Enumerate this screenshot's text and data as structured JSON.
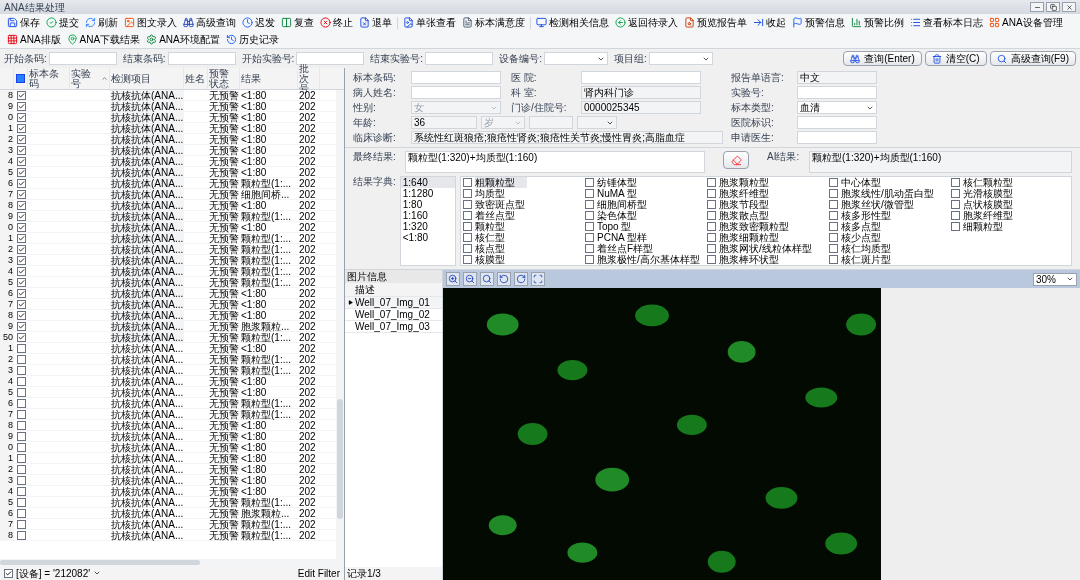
{
  "window": {
    "title": "ANA结果处理"
  },
  "toolbar": [
    [
      "保存",
      "提交",
      "刷新",
      "图文录入",
      "高级查询",
      "迟发",
      "复查",
      "终止",
      "退单"
    ],
    [
      "单张查看",
      "标本满意度"
    ],
    [
      "检测相关信息",
      "返回待录入",
      "预览报告单",
      "收起",
      "预警信息",
      "预警比例",
      "查看标本日志",
      "ANA设备管理",
      "ANA排版",
      "ANA下载结果",
      "ANA环境配置",
      "历史记录"
    ]
  ],
  "filters": [
    {
      "label": "开始条码:",
      "kind": "text"
    },
    {
      "label": "结束条码:",
      "kind": "text"
    },
    {
      "label": "开始实验号:",
      "kind": "text"
    },
    {
      "label": "结束实验号:",
      "kind": "text"
    },
    {
      "label": "设备编号:",
      "kind": "select"
    },
    {
      "label": "项目组:",
      "kind": "select"
    }
  ],
  "query_buttons": [
    "查询(Enter)",
    "清空(C)",
    "高级查询(F9)"
  ],
  "table": {
    "select_all_indeterminate": true,
    "columns": [
      {
        "label": "标本条码",
        "sorted": false
      },
      {
        "label": "实验号",
        "sorted": true
      },
      {
        "label": "检测项目",
        "sorted": false
      },
      {
        "label": "姓名",
        "sorted": false
      },
      {
        "label": "预警状态",
        "sorted": false
      },
      {
        "label": "结果",
        "sorted": false
      },
      {
        "label": "批次号",
        "sorted": false
      }
    ],
    "rows": [
      {
        "num": "8",
        "checked": true,
        "test": "抗核抗体(ANA...",
        "warning": "无预警",
        "result": "<1:80",
        "batch": "202"
      },
      {
        "num": "9",
        "checked": true,
        "test": "抗核抗体(ANA...",
        "warning": "无预警",
        "result": "<1:80",
        "batch": "202"
      },
      {
        "num": "0",
        "checked": true,
        "test": "抗核抗体(ANA...",
        "warning": "无预警",
        "result": "<1:80",
        "batch": "202"
      },
      {
        "num": "1",
        "checked": true,
        "test": "抗核抗体(ANA...",
        "warning": "无预警",
        "result": "<1:80",
        "batch": "202"
      },
      {
        "num": "2",
        "checked": true,
        "test": "抗核抗体(ANA...",
        "warning": "无预警",
        "result": "<1:80",
        "batch": "202"
      },
      {
        "num": "3",
        "checked": true,
        "test": "抗核抗体(ANA...",
        "warning": "无预警",
        "result": "<1:80",
        "batch": "202"
      },
      {
        "num": "4",
        "checked": true,
        "test": "抗核抗体(ANA...",
        "warning": "无预警",
        "result": "<1:80",
        "batch": "202"
      },
      {
        "num": "5",
        "checked": true,
        "test": "抗核抗体(ANA...",
        "warning": "无预警",
        "result": "<1:80",
        "batch": "202"
      },
      {
        "num": "6",
        "checked": true,
        "test": "抗核抗体(ANA...",
        "warning": "无预警",
        "result": "颗粒型(1:...",
        "batch": "202"
      },
      {
        "num": "7",
        "checked": true,
        "test": "抗核抗体(ANA...",
        "warning": "无预警",
        "result": "细胞间桥...",
        "batch": "202"
      },
      {
        "num": "8",
        "checked": true,
        "test": "抗核抗体(ANA...",
        "warning": "无预警",
        "result": "<1:80",
        "batch": "202"
      },
      {
        "num": "9",
        "checked": true,
        "test": "抗核抗体(ANA...",
        "warning": "无预警",
        "result": "颗粒型(1:...",
        "batch": "202"
      },
      {
        "num": "0",
        "checked": true,
        "test": "抗核抗体(ANA...",
        "warning": "无预警",
        "result": "<1:80",
        "batch": "202"
      },
      {
        "num": "1",
        "checked": true,
        "test": "抗核抗体(ANA...",
        "warning": "无预警",
        "result": "颗粒型(1:...",
        "batch": "202"
      },
      {
        "num": "2",
        "checked": true,
        "test": "抗核抗体(ANA...",
        "warning": "无预警",
        "result": "颗粒型(1:...",
        "batch": "202"
      },
      {
        "num": "3",
        "checked": true,
        "test": "抗核抗体(ANA...",
        "warning": "无预警",
        "result": "颗粒型(1:...",
        "batch": "202"
      },
      {
        "num": "4",
        "checked": true,
        "test": "抗核抗体(ANA...",
        "warning": "无预警",
        "result": "颗粒型(1:...",
        "batch": "202"
      },
      {
        "num": "5",
        "checked": true,
        "test": "抗核抗体(ANA...",
        "warning": "无预警",
        "result": "颗粒型(1:...",
        "batch": "202"
      },
      {
        "num": "6",
        "checked": true,
        "test": "抗核抗体(ANA...",
        "warning": "无预警",
        "result": "<1:80",
        "batch": "202"
      },
      {
        "num": "7",
        "checked": true,
        "test": "抗核抗体(ANA...",
        "warning": "无预警",
        "result": "<1:80",
        "batch": "202"
      },
      {
        "num": "8",
        "checked": true,
        "test": "抗核抗体(ANA...",
        "warning": "无预警",
        "result": "<1:80",
        "batch": "202"
      },
      {
        "num": "9",
        "checked": true,
        "test": "抗核抗体(ANA...",
        "warning": "无预警",
        "result": "胞浆颗粒...",
        "batch": "202"
      },
      {
        "num": "50",
        "checked": true,
        "test": "抗核抗体(ANA...",
        "warning": "无预警",
        "result": "颗粒型(1:...",
        "batch": "202"
      },
      {
        "num": "1",
        "checked": false,
        "test": "抗核抗体(ANA...",
        "warning": "无预警",
        "result": "<1:80",
        "batch": "202"
      },
      {
        "num": "2",
        "checked": false,
        "test": "抗核抗体(ANA...",
        "warning": "无预警",
        "result": "颗粒型(1:...",
        "batch": "202"
      },
      {
        "num": "3",
        "checked": false,
        "test": "抗核抗体(ANA...",
        "warning": "无预警",
        "result": "颗粒型(1:...",
        "batch": "202"
      },
      {
        "num": "4",
        "checked": false,
        "test": "抗核抗体(ANA...",
        "warning": "无预警",
        "result": "<1:80",
        "batch": "202"
      },
      {
        "num": "5",
        "checked": false,
        "test": "抗核抗体(ANA...",
        "warning": "无预警",
        "result": "<1:80",
        "batch": "202"
      },
      {
        "num": "6",
        "checked": false,
        "test": "抗核抗体(ANA...",
        "warning": "无预警",
        "result": "颗粒型(1:...",
        "batch": "202"
      },
      {
        "num": "7",
        "checked": false,
        "test": "抗核抗体(ANA...",
        "warning": "无预警",
        "result": "颗粒型(1:...",
        "batch": "202"
      },
      {
        "num": "8",
        "checked": false,
        "test": "抗核抗体(ANA...",
        "warning": "无预警",
        "result": "<1:80",
        "batch": "202"
      },
      {
        "num": "9",
        "checked": false,
        "test": "抗核抗体(ANA...",
        "warning": "无预警",
        "result": "<1:80",
        "batch": "202"
      },
      {
        "num": "0",
        "checked": false,
        "test": "抗核抗体(ANA...",
        "warning": "无预警",
        "result": "<1:80",
        "batch": "202"
      },
      {
        "num": "1",
        "checked": false,
        "test": "抗核抗体(ANA...",
        "warning": "无预警",
        "result": "<1:80",
        "batch": "202"
      },
      {
        "num": "2",
        "checked": false,
        "test": "抗核抗体(ANA...",
        "warning": "无预警",
        "result": "<1:80",
        "batch": "202"
      },
      {
        "num": "3",
        "checked": false,
        "test": "抗核抗体(ANA...",
        "warning": "无预警",
        "result": "<1:80",
        "batch": "202"
      },
      {
        "num": "4",
        "checked": false,
        "test": "抗核抗体(ANA...",
        "warning": "无预警",
        "result": "<1:80",
        "batch": "202"
      },
      {
        "num": "5",
        "checked": false,
        "test": "抗核抗体(ANA...",
        "warning": "无预警",
        "result": "颗粒型(1:...",
        "batch": "202"
      },
      {
        "num": "6",
        "checked": false,
        "test": "抗核抗体(ANA...",
        "warning": "无预警",
        "result": "胞浆颗粒...",
        "batch": "202"
      },
      {
        "num": "7",
        "checked": false,
        "test": "抗核抗体(ANA...",
        "warning": "无预警",
        "result": "颗粒型(1:...",
        "batch": "202"
      },
      {
        "num": "8",
        "checked": false,
        "test": "抗核抗体(ANA...",
        "warning": "无预警",
        "result": "颗粒型(1:...",
        "batch": "202"
      }
    ]
  },
  "status_bar": {
    "filter_checked": true,
    "filter": "[设备] = '212082'",
    "edit_filter": "Edit Filter"
  },
  "patient": {
    "barcode": {
      "label": "标本条码:"
    },
    "hospital": {
      "label": "医 院:"
    },
    "report_language": {
      "label": "报告单语言:",
      "value": "中文"
    },
    "name": {
      "label": "病人姓名:"
    },
    "department": {
      "label": "科 室:",
      "value": "肾内科门诊"
    },
    "lab_no": {
      "label": "实验号:"
    },
    "sex": {
      "label": "性别:",
      "value": "女"
    },
    "outpatient_no": {
      "label": "门诊/住院号:",
      "value": "0000025345"
    },
    "specimen_type": {
      "label": "标本类型:",
      "value": "血清"
    },
    "age": {
      "label": "年龄:",
      "value": "36",
      "unit": "岁"
    },
    "hospital_id": {
      "label": "医院标识:"
    },
    "diagnosis": {
      "label": "临床诊断:",
      "value": "系统性红斑狼疮;狼疮性肾炎;狼疮性关节炎;慢性胃炎;高脂血症"
    },
    "doctor": {
      "label": "申请医生:"
    }
  },
  "result": {
    "final_label": "最终结果:",
    "final_value": "颗粒型(1:320)+均质型(1:160)",
    "ai_label": "AI结果:",
    "ai_value": "颗粒型(1:320)+均质型(1:160)",
    "dictionary_label": "结果字典:",
    "titers": [
      {
        "label": "1:640",
        "selected": true
      },
      {
        "label": "1:1280",
        "selected": false
      },
      {
        "label": "1:80",
        "selected": false
      },
      {
        "label": "1:160",
        "selected": false
      },
      {
        "label": "1:320",
        "selected": false
      },
      {
        "label": "<1:80",
        "selected": false
      }
    ],
    "patterns": [
      [
        {
          "label": "粗颗粒型",
          "checked": false,
          "selected": true
        },
        {
          "label": "均质型",
          "checked": false,
          "selected": false
        },
        {
          "label": "致密斑点型",
          "checked": false,
          "selected": false
        },
        {
          "label": "着丝点型",
          "checked": false,
          "selected": false
        },
        {
          "label": "颗粒型",
          "checked": false,
          "selected": false
        },
        {
          "label": "核仁型",
          "checked": false,
          "selected": false
        },
        {
          "label": "核点型",
          "checked": false,
          "selected": false
        },
        {
          "label": "核膜型",
          "checked": false,
          "selected": false
        }
      ],
      [
        {
          "label": "纺锤体型",
          "checked": false,
          "selected": false
        },
        {
          "label": "NuMA 型",
          "checked": false,
          "selected": false
        },
        {
          "label": "细胞间桥型",
          "checked": false,
          "selected": false
        },
        {
          "label": "染色体型",
          "checked": false,
          "selected": false
        },
        {
          "label": "Topo 型",
          "checked": false,
          "selected": false
        },
        {
          "label": "PCNA 型样",
          "checked": false,
          "selected": false
        },
        {
          "label": "着丝点F样型",
          "checked": false,
          "selected": false
        },
        {
          "label": "胞浆极性/高尔基体样型",
          "checked": false,
          "selected": false
        }
      ],
      [
        {
          "label": "胞浆颗粒型",
          "checked": false,
          "selected": false
        },
        {
          "label": "胞浆纤维型",
          "checked": false,
          "selected": false
        },
        {
          "label": "胞浆节段型",
          "checked": false,
          "selected": false
        },
        {
          "label": "胞浆散点型",
          "checked": false,
          "selected": false
        },
        {
          "label": "胞浆致密颗粒型",
          "checked": false,
          "selected": false
        },
        {
          "label": "胞浆细颗粒型",
          "checked": false,
          "selected": false
        },
        {
          "label": "胞浆网状/线粒体样型",
          "checked": false,
          "selected": false
        },
        {
          "label": "胞浆棒环状型",
          "checked": false,
          "selected": false
        }
      ],
      [
        {
          "label": "中心体型",
          "checked": false,
          "selected": false
        },
        {
          "label": "胞浆线性/肌动蛋白型",
          "checked": false,
          "selected": false
        },
        {
          "label": "胞浆丝状/微管型",
          "checked": false,
          "selected": false
        },
        {
          "label": "核多形性型",
          "checked": false,
          "selected": false
        },
        {
          "label": "核多点型",
          "checked": false,
          "selected": false
        },
        {
          "label": "核少点型",
          "checked": false,
          "selected": false
        },
        {
          "label": "核仁均质型",
          "checked": false,
          "selected": false
        },
        {
          "label": "核仁斑片型",
          "checked": false,
          "selected": false
        }
      ],
      [
        {
          "label": "核仁颗粒型",
          "checked": false,
          "selected": false
        },
        {
          "label": "光滑核膜型",
          "checked": false,
          "selected": false
        },
        {
          "label": "点状核膜型",
          "checked": false,
          "selected": false
        },
        {
          "label": "胞浆纤维型",
          "checked": false,
          "selected": false
        },
        {
          "label": "细颗粒型",
          "checked": false,
          "selected": false
        }
      ]
    ]
  },
  "images": {
    "title": "图片信息",
    "column": "描述",
    "items": [
      {
        "label": "Well_07_Img_01",
        "selected": true
      },
      {
        "label": "Well_07_Img_02",
        "selected": false
      },
      {
        "label": "Well_07_Img_03",
        "selected": false
      }
    ],
    "record": "记录1/3",
    "zoom": "30%"
  }
}
